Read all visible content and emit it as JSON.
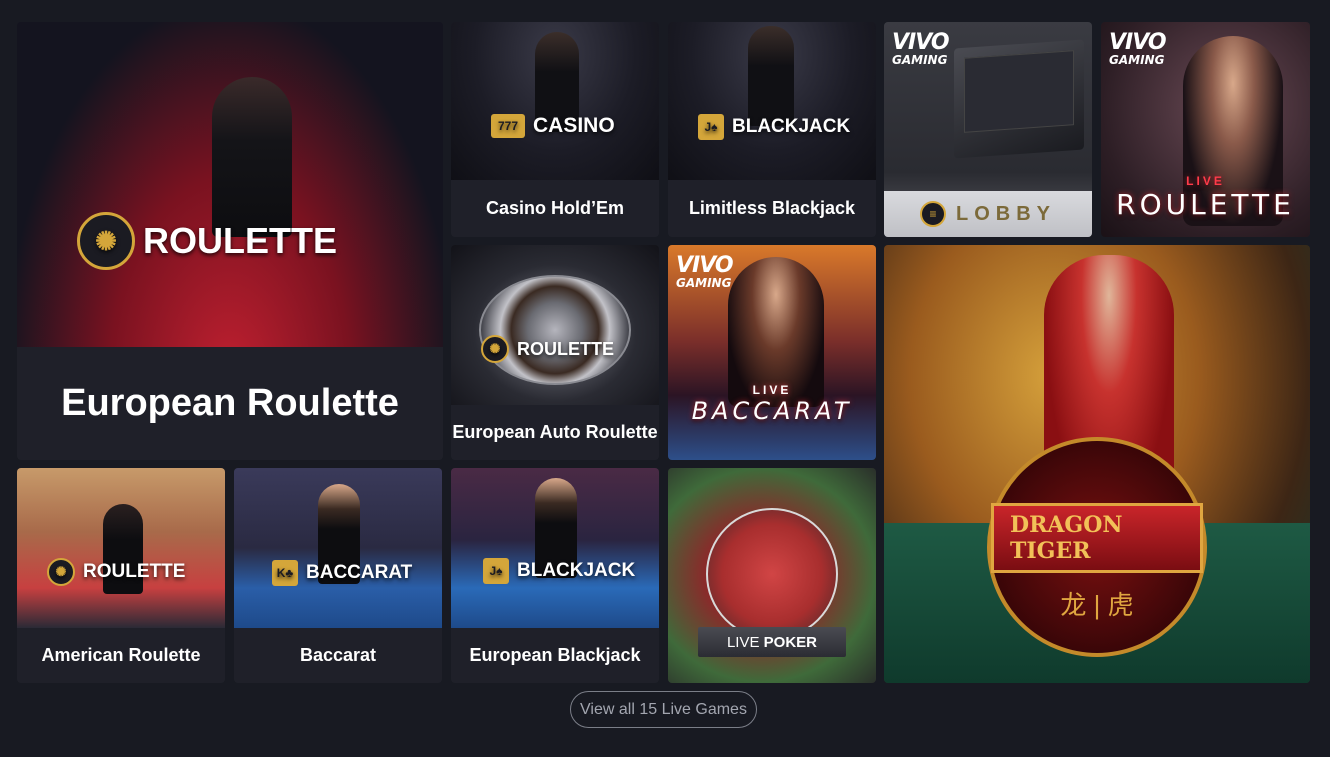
{
  "games": {
    "european_roulette": {
      "thumb_label": "ROULETTE",
      "caption": "European Roulette"
    },
    "casino_holdem": {
      "thumb_label": "CASINO",
      "caption": "Casino Hold’Em"
    },
    "limitless_blackjack": {
      "thumb_label": "BLACKJACK",
      "caption": "Limitless Blackjack"
    },
    "lobby": {
      "brand_top": "VIVO",
      "brand_bottom": "GAMING",
      "thumb_label": "LOBBY"
    },
    "live_roulette": {
      "brand_top": "VIVO",
      "brand_bottom": "GAMING",
      "live_tag": "LIVE",
      "thumb_label": "ROULETTE"
    },
    "european_auto_roulette": {
      "thumb_label": "ROULETTE",
      "caption": "European Auto Roulette"
    },
    "live_baccarat": {
      "brand_top": "VIVO",
      "brand_bottom": "GAMING",
      "live_tag": "LIVE",
      "thumb_label": "BACCARAT"
    },
    "dragon_tiger": {
      "thumb_label": "DRAGON TIGER",
      "thumb_label_cn": "龙 | 虎"
    },
    "american_roulette": {
      "thumb_label": "ROULETTE",
      "caption": "American Roulette"
    },
    "baccarat": {
      "thumb_label": "BACCARAT",
      "caption": "Baccarat"
    },
    "european_blackjack": {
      "thumb_label": "BLACKJACK",
      "caption": "European Blackjack"
    },
    "live_poker": {
      "thumb_label_prefix": "LIVE",
      "thumb_label_suffix": "POKER"
    }
  },
  "view_all": {
    "label": "View all 15 Live Games"
  },
  "colors": {
    "background": "#181a22",
    "tile": "#1f2029",
    "gold": "#d4a63a",
    "button_border": "#7b7e88",
    "button_text": "#a3a6b0"
  }
}
